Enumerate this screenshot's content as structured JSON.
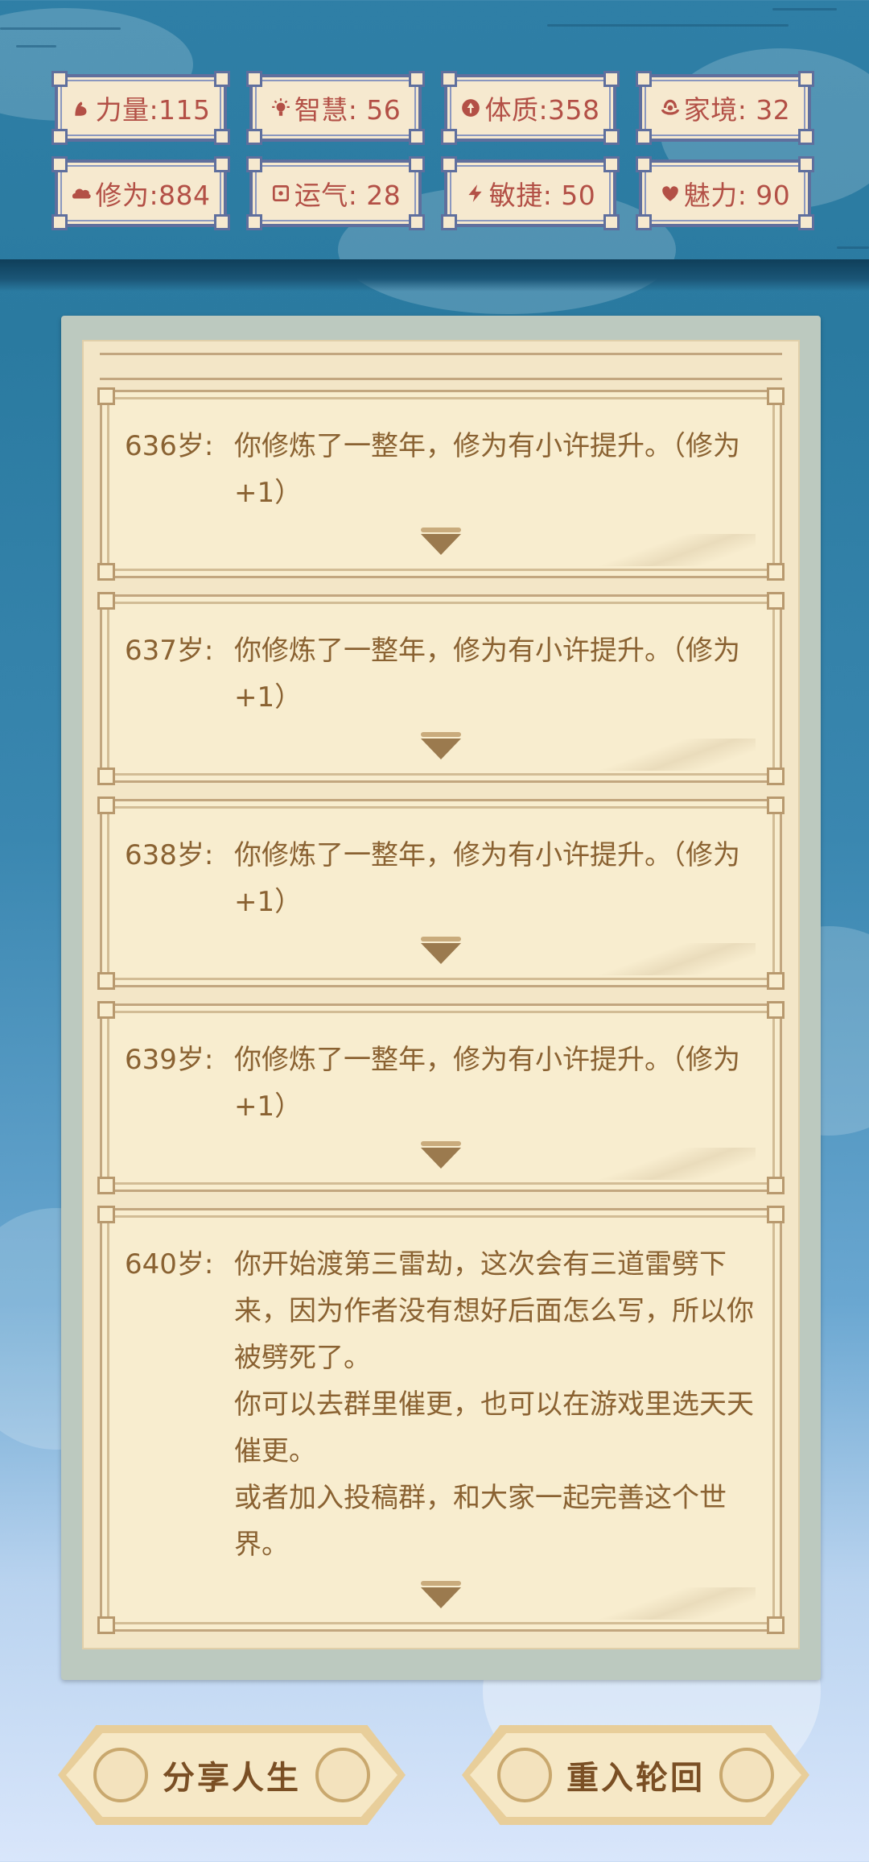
{
  "stats": [
    {
      "icon": "strength-icon",
      "label": "力量:115"
    },
    {
      "icon": "wisdom-icon",
      "label": "智慧: 56"
    },
    {
      "icon": "constitution-icon",
      "label": "体质:358"
    },
    {
      "icon": "family-icon",
      "label": "家境: 32"
    },
    {
      "icon": "cultivation-icon",
      "label": "修为:884"
    },
    {
      "icon": "luck-icon",
      "label": "运气: 28"
    },
    {
      "icon": "agility-icon",
      "label": "敏捷: 50"
    },
    {
      "icon": "charm-icon",
      "label": "魅力: 90"
    }
  ],
  "entries": [
    {
      "age": "636岁:",
      "lines": [
        "你修炼了一整年，修为有小许提升。（修为+1）"
      ]
    },
    {
      "age": "637岁:",
      "lines": [
        "你修炼了一整年，修为有小许提升。（修为+1）"
      ]
    },
    {
      "age": "638岁:",
      "lines": [
        "你修炼了一整年，修为有小许提升。（修为+1）"
      ]
    },
    {
      "age": "639岁:",
      "lines": [
        "你修炼了一整年，修为有小许提升。（修为+1）"
      ]
    },
    {
      "age": "640岁:",
      "lines": [
        "你开始渡第三雷劫，这次会有三道雷劈下来，因为作者没有想好后面怎么写，所以你被劈死了。",
        "你可以去群里催更，也可以在游戏里选天天催更。",
        "或者加入投稿群，和大家一起完善这个世界。"
      ]
    }
  ],
  "buttons": {
    "share": "分享人生",
    "restart": "重入轮回"
  },
  "colors": {
    "stat_text": "#b35046",
    "entry_text": "#8a6232",
    "button_text": "#7a4f24",
    "badge_border": "#5f6f9d"
  }
}
